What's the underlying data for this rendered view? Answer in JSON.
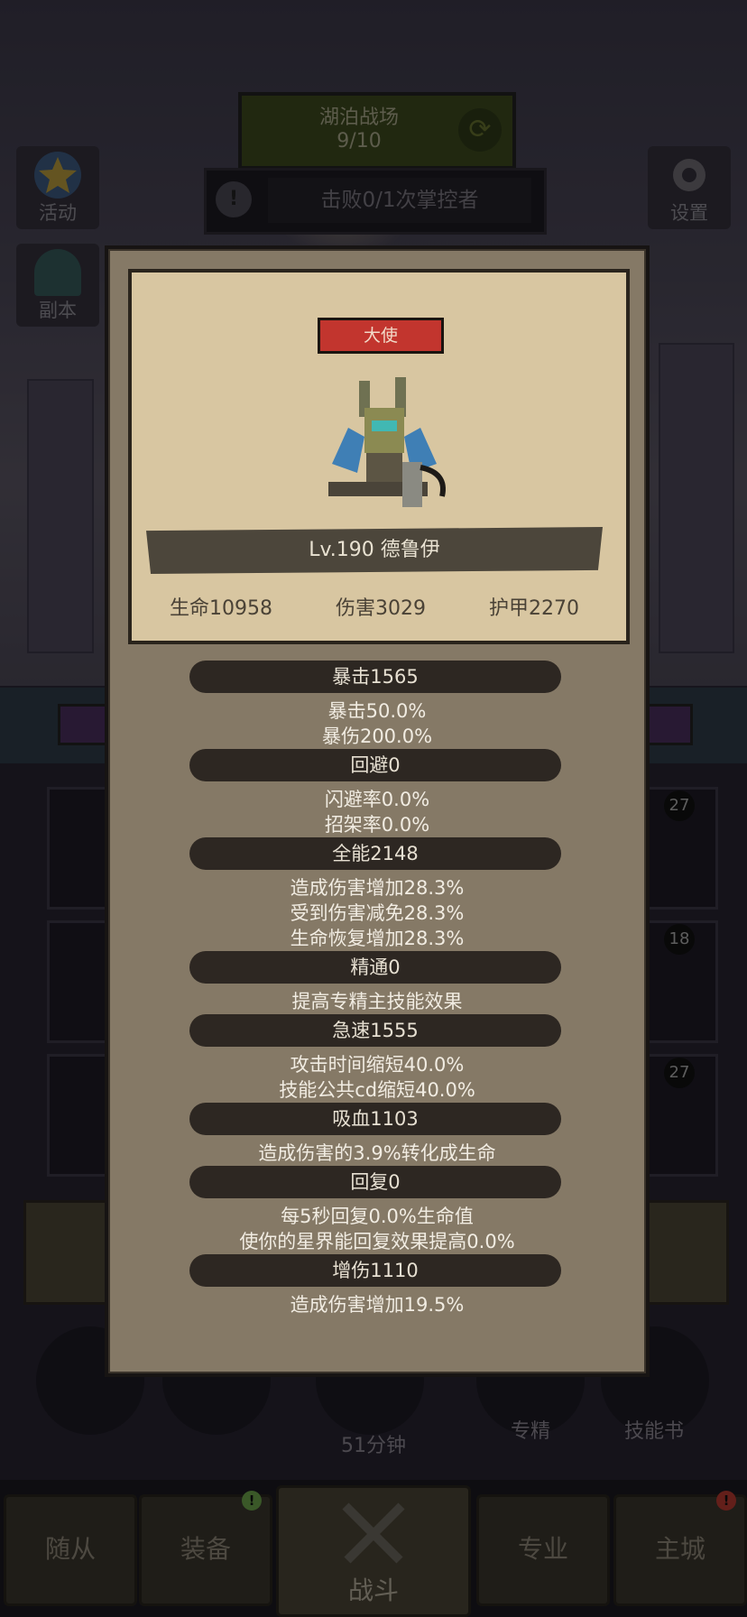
{
  "stage": {
    "title": "湖泊战场",
    "progress": "9/10"
  },
  "quest": {
    "text": "击败0/1次掌控者"
  },
  "left_buttons": [
    {
      "label": "活动"
    },
    {
      "label": "副本"
    }
  ],
  "right_buttons": [
    {
      "label": "设置"
    }
  ],
  "background": {
    "slot_badges": [
      "27",
      "18",
      "27"
    ],
    "timer_label": "51分钟",
    "specialty_label": "专精",
    "skillbook_label": "技能书"
  },
  "bottom_nav": [
    {
      "label": "随从"
    },
    {
      "label": "装备"
    },
    {
      "label": "战斗"
    },
    {
      "label": "专业"
    },
    {
      "label": "主城"
    }
  ],
  "hero": {
    "rank": "大使",
    "level_name": "Lv.190 德鲁伊",
    "hp": "生命10958",
    "damage": "伤害3029",
    "armor": "护甲2270"
  },
  "stats": {
    "crit": {
      "header": "暴击1565",
      "lines": [
        "暴击50.0%",
        "暴伤200.0%"
      ]
    },
    "dodge": {
      "header": "回避0",
      "lines": [
        "闪避率0.0%",
        "招架率0.0%"
      ]
    },
    "versatility": {
      "header": "全能2148",
      "lines": [
        "造成伤害增加28.3%",
        "受到伤害减免28.3%",
        "生命恢复增加28.3%"
      ]
    },
    "mastery": {
      "header": "精通0",
      "lines": [
        "提高专精主技能效果"
      ]
    },
    "haste": {
      "header": "急速1555",
      "lines": [
        "攻击时间缩短40.0%",
        "技能公共cd缩短40.0%"
      ]
    },
    "leech": {
      "header": "吸血1103",
      "lines": [
        "造成伤害的3.9%转化成生命"
      ]
    },
    "regen": {
      "header": "回复0",
      "lines": [
        "每5秒回复0.0%生命值",
        "使你的星界能回复效果提高0.0%"
      ]
    },
    "dmg_boost": {
      "header": "增伤1110",
      "lines": [
        "造成伤害增加19.5%"
      ]
    }
  }
}
